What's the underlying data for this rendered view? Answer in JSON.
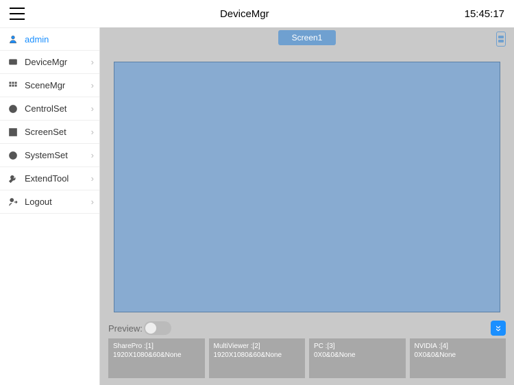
{
  "header": {
    "title": "DeviceMgr",
    "time": "15:45:17"
  },
  "sidebar": {
    "user_label": "admin",
    "items": [
      {
        "label": "DeviceMgr"
      },
      {
        "label": "SceneMgr"
      },
      {
        "label": "CentrolSet"
      },
      {
        "label": "ScreenSet"
      },
      {
        "label": "SystemSet"
      },
      {
        "label": "ExtendTool"
      },
      {
        "label": "Logout"
      }
    ]
  },
  "tabs": {
    "active": "Screen1"
  },
  "preview": {
    "label": "Preview:"
  },
  "sources": [
    {
      "title": "SharePro :[1]",
      "res": "1920X1080&60&None"
    },
    {
      "title": "MultiViewer :[2]",
      "res": "1920X1080&60&None"
    },
    {
      "title": "PC :[3]",
      "res": "0X0&0&None"
    },
    {
      "title": "NVIDIA :[4]",
      "res": "0X0&0&None"
    }
  ]
}
